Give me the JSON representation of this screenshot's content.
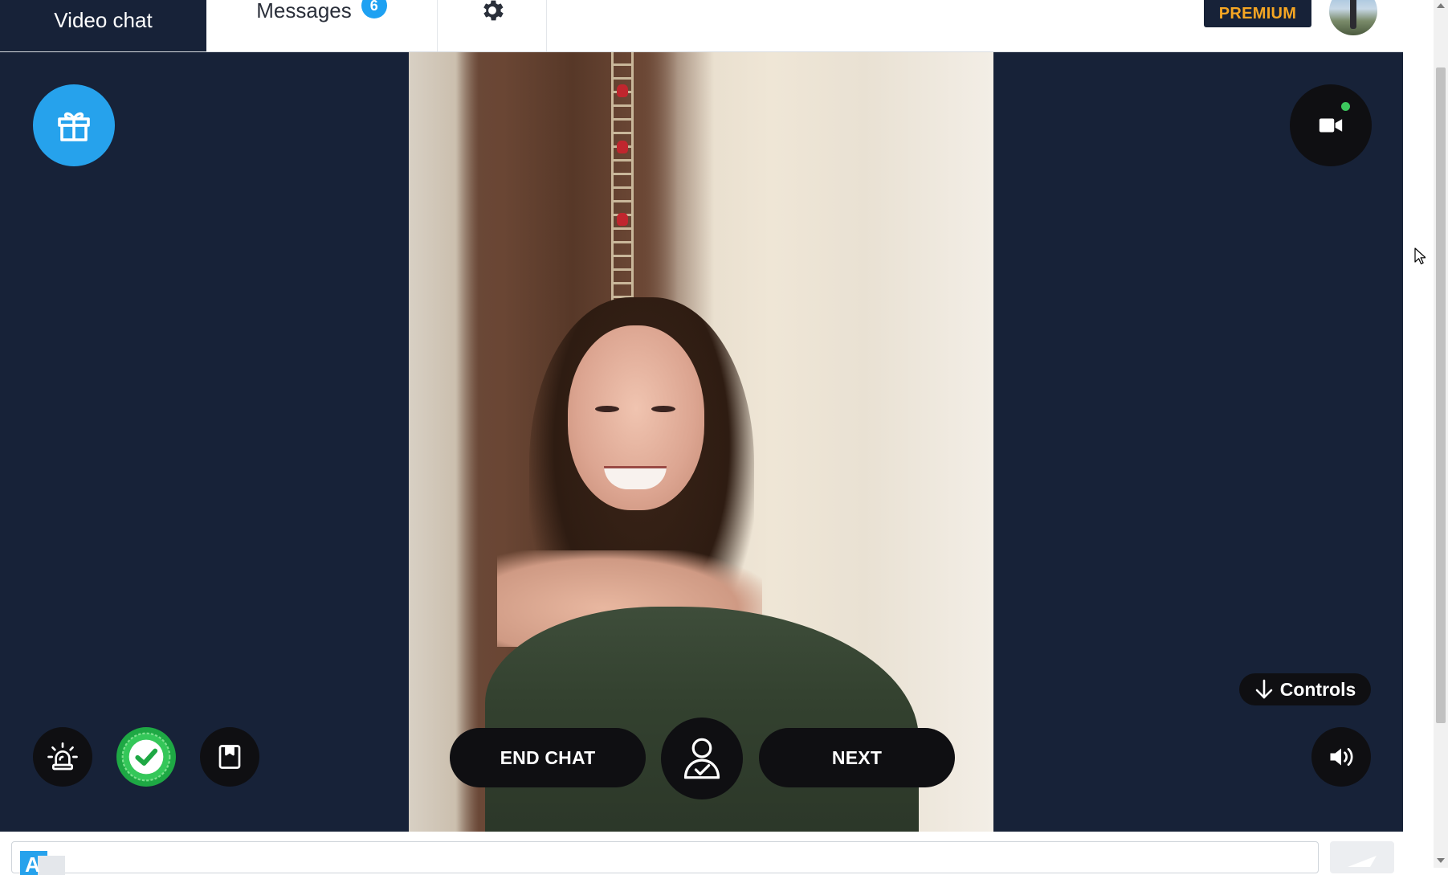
{
  "tabs": {
    "video_chat": "Video chat",
    "messages": "Messages",
    "messages_badge": "6",
    "settings_icon": "gear-icon"
  },
  "header": {
    "premium_label": "PREMIUM",
    "avatar_icon": "user-avatar"
  },
  "stage": {
    "gift_icon": "gift-icon",
    "camera_icon": "video-camera-icon",
    "camera_status_color": "#3cc65d",
    "controls_label": "Controls",
    "controls_icon": "arrow-down-icon"
  },
  "actions": {
    "end_chat_label": "END CHAT",
    "next_label": "NEXT",
    "profile_icon": "user-check-icon",
    "alarm_icon": "alarm-icon",
    "verified_icon": "verified-badge-icon",
    "bookmark_icon": "bookmark-icon",
    "volume_icon": "volume-icon"
  },
  "chat_input": {
    "value": "",
    "translate_icon": "translate-icon",
    "send_icon": "send-icon"
  },
  "colors": {
    "dark_bg": "#172238",
    "accent_blue": "#26a2ec",
    "premium_orange": "#f5a623",
    "verified_green": "#1ea844"
  }
}
